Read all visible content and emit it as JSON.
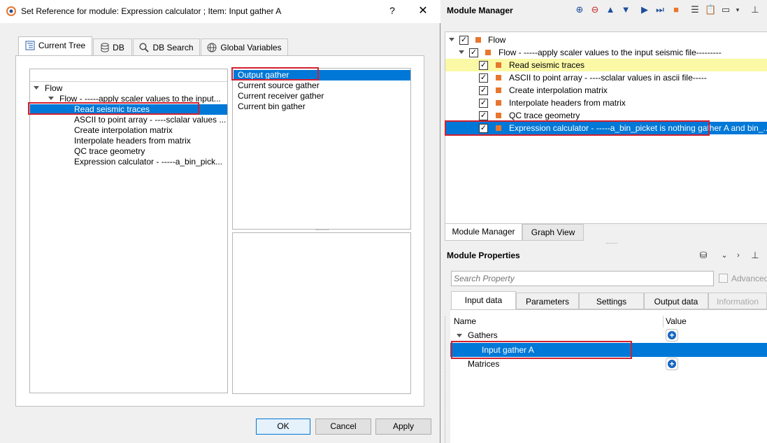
{
  "dialog": {
    "title": "Set Reference for module: Expression calculator ; Item: Input gather A",
    "help_label": "?",
    "close_label": "✕",
    "tabs": [
      {
        "label": "Current Tree"
      },
      {
        "label": "DB"
      },
      {
        "label": "DB Search"
      },
      {
        "label": "Global Variables"
      }
    ],
    "tree": {
      "root": "Flow",
      "flow": "Flow - -----apply scaler values to the input...",
      "items": [
        "Read seismic traces",
        "ASCII to point array - ----sclalar values ...",
        "Create interpolation matrix",
        "Interpolate headers from matrix",
        "QC trace geometry",
        "Expression calculator - -----a_bin_pick..."
      ]
    },
    "references": [
      "Output gather",
      "Current source gather",
      "Current receiver gather",
      "Current bin gather"
    ],
    "buttons": {
      "ok": "OK",
      "cancel": "Cancel",
      "apply": "Apply"
    }
  },
  "module_manager": {
    "title": "Module Manager",
    "tree": {
      "root": "Flow",
      "flow": "Flow - -----apply scaler values to the input seismic file---------",
      "items": [
        "Read seismic traces",
        "ASCII to point array - ----sclalar values in ascii file-----",
        "Create interpolation matrix",
        "Interpolate headers from matrix",
        "QC trace geometry",
        "Expression calculator - -----a_bin_picket is nothing gather A and bin_..."
      ]
    },
    "tabs": [
      "Module Manager",
      "Graph View"
    ]
  },
  "module_properties": {
    "title": "Module Properties",
    "search_placeholder": "Search Property",
    "advanced_label": "Advanced",
    "tabs": [
      "Input data",
      "Parameters",
      "Settings",
      "Output data",
      "Information"
    ],
    "columns": {
      "name": "Name",
      "value": "Value"
    },
    "rows": {
      "gathers": "Gathers",
      "input_gather": "Input gather A",
      "matrices": "Matrices"
    }
  },
  "colors": {
    "selection": "#0078d7",
    "highlight": "#fbf8a6",
    "module_square": "#e8762d",
    "annotation": "#d1202f"
  }
}
